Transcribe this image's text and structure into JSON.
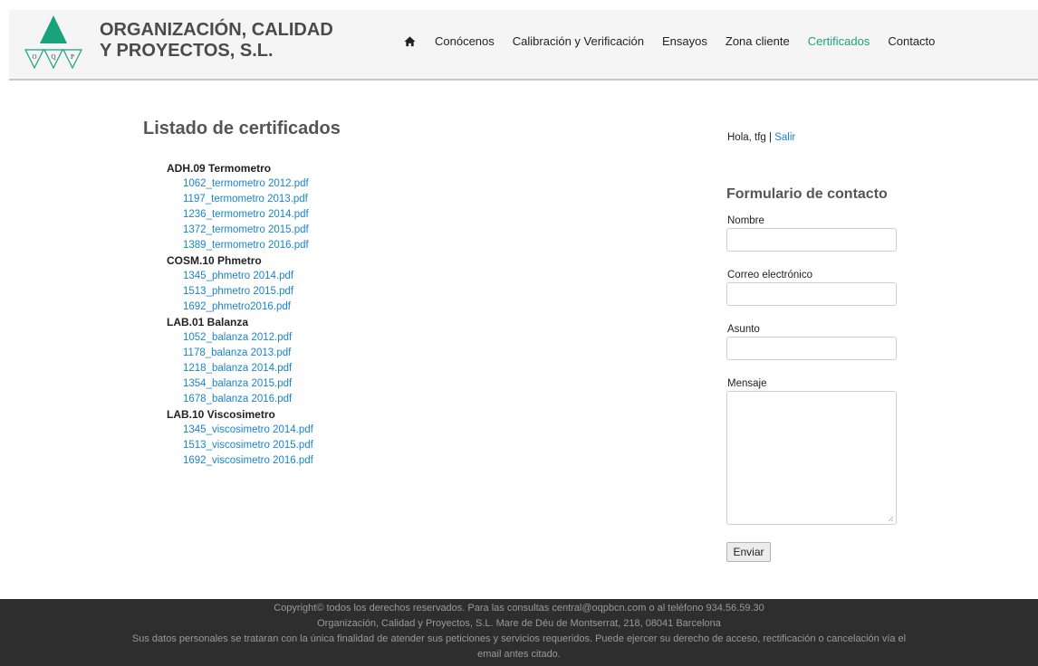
{
  "header": {
    "logo_letters": [
      "O",
      "Q",
      "P"
    ],
    "brand_line1": "ORGANIZACIÓN, CALIDAD",
    "brand_line2": "Y PROYECTOS, S.L.",
    "nav": [
      {
        "label": "Conócenos"
      },
      {
        "label": "Calibración y Verificación"
      },
      {
        "label": "Ensayos"
      },
      {
        "label": "Zona cliente"
      },
      {
        "label": "Certificados",
        "active": true
      },
      {
        "label": "Contacto"
      }
    ]
  },
  "main": {
    "title": "Listado de certificados",
    "groups": [
      {
        "title": "ADH.09 Termometro",
        "files": [
          "1062_termometro 2012.pdf",
          "1197_termometro 2013.pdf",
          "1236_termometro 2014.pdf",
          "1372_termometro 2015.pdf",
          "1389_termometro 2016.pdf"
        ]
      },
      {
        "title": "COSM.10 Phmetro",
        "files": [
          "1345_phmetro 2014.pdf",
          "1513_phmetro 2015.pdf",
          "1692_phmetro2016.pdf"
        ]
      },
      {
        "title": "LAB.01 Balanza",
        "files": [
          "1052_balanza 2012.pdf",
          "1178_balanza 2013.pdf",
          "1218_balanza 2014.pdf",
          "1354_balanza 2015.pdf",
          "1678_balanza 2016.pdf"
        ]
      },
      {
        "title": "LAB.10 Viscosimetro",
        "files": [
          "1345_viscosimetro 2014.pdf",
          "1513_viscosimetro 2015.pdf",
          "1692_viscosimetro 2016.pdf"
        ]
      }
    ]
  },
  "sidebar": {
    "greeting": "Hola, tfg |",
    "logout": "Salir",
    "form_title": "Formulario de contacto",
    "name_label": "Nombre",
    "email_label": "Correo electrónico",
    "subject_label": "Asunto",
    "message_label": "Mensaje",
    "name_value": "",
    "email_value": "",
    "subject_value": "",
    "message_value": "",
    "submit_label": "Enviar"
  },
  "footer": {
    "line1": "Copyright© todos los derechos reservados. Para las consultas central@oqpbcn.com o al teléfono 934.56.59.30",
    "line2": "Organización, Calidad y Proyectos, S.L. Mare de Déu de Montserrat, 218, 08041 Barcelona",
    "line3": "Sus datos personales se trataran con la única finalidad de atender sus peticiones y servicios requeridos. Puede ejercer su derecho de acceso, rectificación o cancelación vía el email antes citado."
  },
  "colors": {
    "logo_green": "#1aa37a",
    "link_blue": "#1a84cc",
    "active_nav": "#1aa37a",
    "footer_bg": "#2e2e2e"
  },
  "icons": {
    "home": "home-icon"
  }
}
